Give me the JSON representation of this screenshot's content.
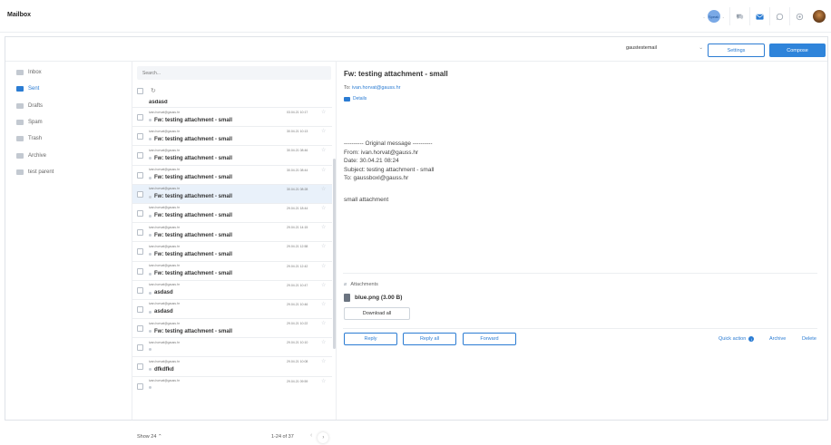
{
  "app": {
    "title": "Mailbox"
  },
  "topbar": {
    "status_text": "Speak",
    "icons": [
      "chat-icon",
      "mail-icon",
      "whatsapp-icon",
      "settings-icon"
    ]
  },
  "actionbar": {
    "account": "gaustestemail",
    "settings_label": "Settings",
    "compose_label": "Compose"
  },
  "sidebar": {
    "items": [
      {
        "label": "Inbox",
        "active": false
      },
      {
        "label": "Sent",
        "active": true
      },
      {
        "label": "Drafts",
        "active": false
      },
      {
        "label": "Spam",
        "active": false
      },
      {
        "label": "Trash",
        "active": false
      },
      {
        "label": "Archive",
        "active": false
      },
      {
        "label": "test parent",
        "active": false
      }
    ]
  },
  "list": {
    "search_placeholder": "Search...",
    "first_partial_subject": "asdasd",
    "rows": [
      {
        "from": "ivan.horvat@gauss.hr",
        "subject": "Fw: testing attachment - small",
        "date": "03.04.21 10:17"
      },
      {
        "from": "ivan.horvat@gauss.hr",
        "subject": "Fw: testing attachment - small",
        "date": "30.04.21 10:13"
      },
      {
        "from": "ivan.horvat@gauss.hr",
        "subject": "Fw: testing attachment - small",
        "date": "30.04.21 08:46"
      },
      {
        "from": "ivan.horvat@gauss.hr",
        "subject": "Fw: testing attachment - small",
        "date": "30.04.21 08:44"
      },
      {
        "from": "ivan.horvat@gauss.hr",
        "subject": "Fw: testing attachment - small",
        "date": "30.04.21 08:28",
        "selected": true
      },
      {
        "from": "ivan.horvat@gauss.hr",
        "subject": "Fw: testing attachment - small",
        "date": "29.04.21 18:44"
      },
      {
        "from": "ivan.horvat@gauss.hr",
        "subject": "Fw: testing attachment - small",
        "date": "29.04.21 14:15"
      },
      {
        "from": "ivan.horvat@gauss.hr",
        "subject": "Fw: testing attachment - small",
        "date": "29.04.21 12:58"
      },
      {
        "from": "ivan.horvat@gauss.hr",
        "subject": "Fw: testing attachment - small",
        "date": "29.04.21 12:42"
      },
      {
        "from": "ivan.horvat@gauss.hr",
        "subject": "asdasd",
        "date": "29.04.21 10:47"
      },
      {
        "from": "ivan.horvat@gauss.hr",
        "subject": "asdasd",
        "date": "29.04.21 10:46"
      },
      {
        "from": "ivan.horvat@gauss.hr",
        "subject": "Fw: testing attachment - small",
        "date": "29.04.21 10:22"
      },
      {
        "from": "ivan.horvat@gauss.hr",
        "subject": "",
        "date": "29.04.21 10:10"
      },
      {
        "from": "ivan.horvat@gauss.hr",
        "subject": "dfkdfkd",
        "date": "29.04.21 10:08"
      },
      {
        "from": "ivan.horvat@gauss.hr",
        "subject": "",
        "date": "29.04.21 09:59"
      }
    ],
    "show_label": "Show 24",
    "range_label": "1-24 of 37"
  },
  "reader": {
    "subject": "Fw: testing attachment - small",
    "to_prefix": "To:",
    "to_address": "ivan.horvat@gauss.hr",
    "details_label": "Details",
    "body": {
      "header_line": "---------- Original message ----------",
      "from_line": "From: ivan.horvat@gauss.hr",
      "date_line": "Date: 30.04.21 08:24",
      "subject_line": "Subject: testing attachment - small",
      "to_line": "To: gaussboxl@gauss.hr",
      "content": "small attachment"
    },
    "attachments_label": "Attachments",
    "attachment_name": "blue.png (3.00 B)",
    "download_label": "Download all",
    "reply_label": "Reply",
    "reply_all_label": "Reply all",
    "forward_label": "Forward",
    "quick_action_label": "Quick action",
    "archive_label": "Archive",
    "delete_label": "Delete"
  },
  "colors": {
    "accent": "#2b7cd3",
    "compose_bg": "#2f84da",
    "selected_row": "#e9f1fa"
  }
}
